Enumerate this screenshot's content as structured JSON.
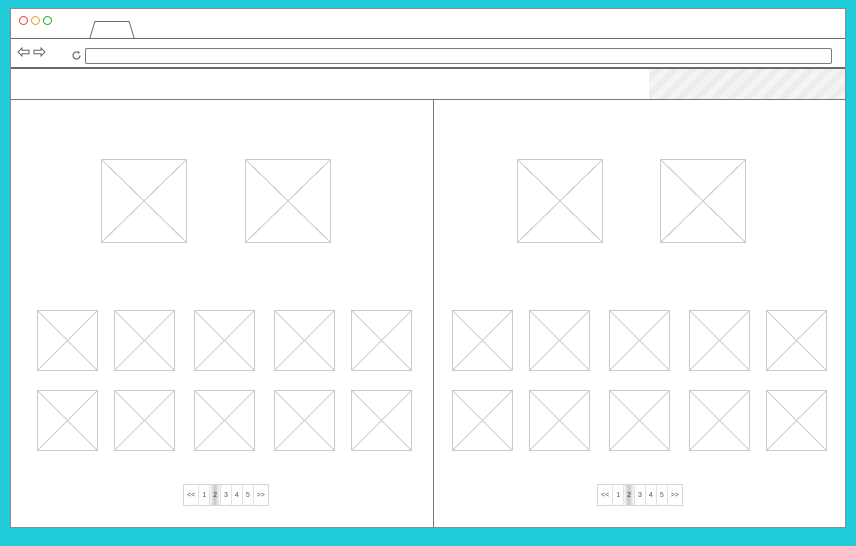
{
  "browser": {
    "window_controls": [
      "close",
      "minimize",
      "zoom"
    ],
    "icons": {
      "back": "back-arrow-icon",
      "forward": "forward-arrow-icon",
      "refresh": "refresh-icon"
    },
    "url_value": ""
  },
  "panels": [
    {
      "id": "left",
      "pager": {
        "items": [
          "<<",
          "1",
          "2",
          "3",
          "4",
          "5",
          ">>"
        ],
        "active": "2"
      }
    },
    {
      "id": "right",
      "pager": {
        "items": [
          "<<",
          "1",
          "2",
          "3",
          "4",
          "5",
          ">>"
        ],
        "active": "2"
      }
    }
  ],
  "colors": {
    "frame_background": "#1fcbd6",
    "page_background": "#ffffff",
    "wireframe_line": "#cfcfcf"
  }
}
